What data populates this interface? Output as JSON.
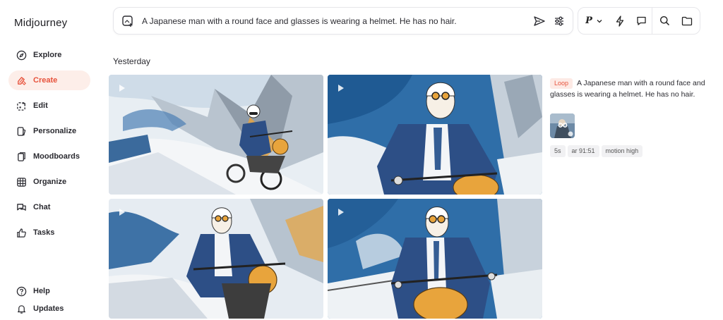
{
  "app": {
    "title": "Midjourney"
  },
  "sidebar": {
    "items": [
      {
        "label": "Explore",
        "icon": "compass-icon"
      },
      {
        "label": "Create",
        "icon": "brush-icon",
        "active": true
      },
      {
        "label": "Edit",
        "icon": "edit-icon"
      },
      {
        "label": "Personalize",
        "icon": "personalize-icon"
      },
      {
        "label": "Moodboards",
        "icon": "moodboards-icon"
      },
      {
        "label": "Organize",
        "icon": "grid-icon"
      },
      {
        "label": "Chat",
        "icon": "chat-icon"
      },
      {
        "label": "Tasks",
        "icon": "thumbs-up-icon"
      }
    ],
    "bottom": [
      {
        "label": "Help",
        "icon": "help-icon"
      },
      {
        "label": "Updates",
        "icon": "bell-icon"
      }
    ]
  },
  "prompt": {
    "text": "A Japanese man with a round face and glasses is wearing a helmet. He has no hair."
  },
  "toolbar": {
    "personalize_label": "P"
  },
  "main": {
    "section_title": "Yesterday"
  },
  "detail": {
    "badge": "Loop",
    "prompt": "A Japanese man with a round face and glasses is wearing a helmet. He has no hair.",
    "chips": [
      "5s",
      "ar 91:51",
      "motion high"
    ]
  },
  "colors": {
    "accent": "#e7523b",
    "accent_bg": "#fdeee9",
    "sky_blue": "#2f6ea8",
    "jacket_blue": "#2d4f86",
    "tank_orange": "#e8a43c"
  }
}
